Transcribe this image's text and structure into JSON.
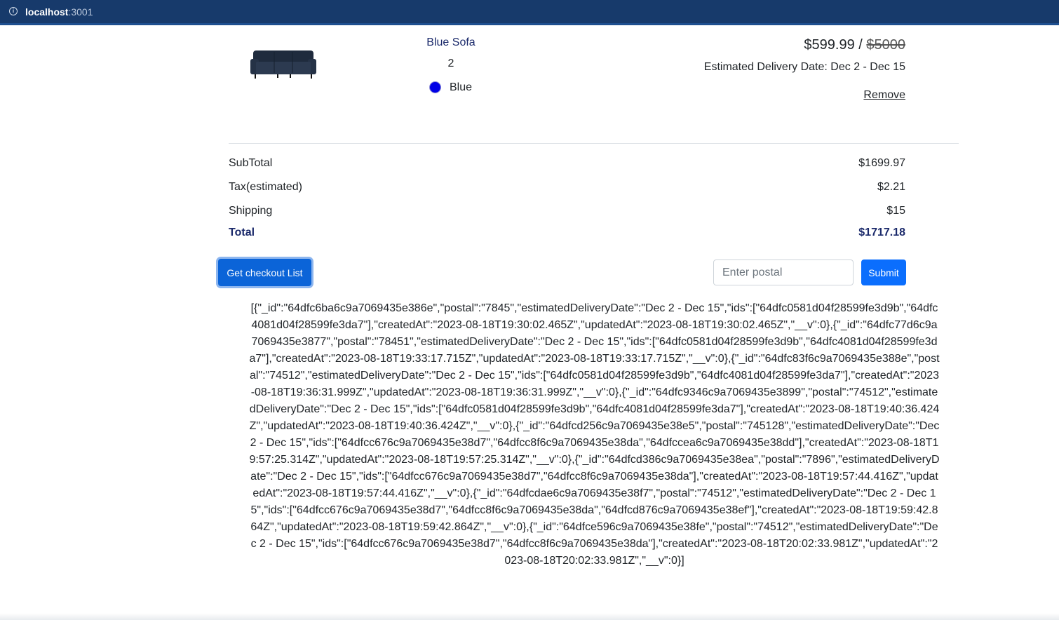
{
  "browser": {
    "url_host": "localhost",
    "url_port": ":3001"
  },
  "cart_item": {
    "name": "Blue Sofa",
    "quantity": "2",
    "color_label": "Blue",
    "color_hex": "#0000e6",
    "price": "$599.99 / ",
    "original_price": "$5000",
    "delivery": "Estimated Delivery Date: Dec 2 - Dec 15",
    "remove_label": "Remove"
  },
  "summary": {
    "subtotal_label": "SubTotal",
    "subtotal_value": "$1699.97",
    "tax_label": "Tax(estimated)",
    "tax_value": "$2.21",
    "shipping_label": "Shipping",
    "shipping_value": "$15",
    "total_label": "Total",
    "total_value": "$1717.18"
  },
  "actions": {
    "checkout_list_label": "Get checkout List",
    "postal_placeholder": "Enter postal",
    "postal_value": "",
    "submit_label": "Submit"
  },
  "checkout_list_output": "[{\"_id\":\"64dfc6ba6c9a7069435e386e\",\"postal\":\"7845\",\"estimatedDeliveryDate\":\"Dec 2 - Dec 15\",\"ids\":[\"64dfc0581d04f28599fe3d9b\",\"64dfc4081d04f28599fe3da7\"],\"createdAt\":\"2023-08-18T19:30:02.465Z\",\"updatedAt\":\"2023-08-18T19:30:02.465Z\",\"__v\":0},{\"_id\":\"64dfc77d6c9a7069435e3877\",\"postal\":\"78451\",\"estimatedDeliveryDate\":\"Dec 2 - Dec 15\",\"ids\":[\"64dfc0581d04f28599fe3d9b\",\"64dfc4081d04f28599fe3da7\"],\"createdAt\":\"2023-08-18T19:33:17.715Z\",\"updatedAt\":\"2023-08-18T19:33:17.715Z\",\"__v\":0},{\"_id\":\"64dfc83f6c9a7069435e388e\",\"postal\":\"74512\",\"estimatedDeliveryDate\":\"Dec 2 - Dec 15\",\"ids\":[\"64dfc0581d04f28599fe3d9b\",\"64dfc4081d04f28599fe3da7\"],\"createdAt\":\"2023-08-18T19:36:31.999Z\",\"updatedAt\":\"2023-08-18T19:36:31.999Z\",\"__v\":0},{\"_id\":\"64dfc9346c9a7069435e3899\",\"postal\":\"74512\",\"estimatedDeliveryDate\":\"Dec 2 - Dec 15\",\"ids\":[\"64dfc0581d04f28599fe3d9b\",\"64dfc4081d04f28599fe3da7\"],\"createdAt\":\"2023-08-18T19:40:36.424Z\",\"updatedAt\":\"2023-08-18T19:40:36.424Z\",\"__v\":0},{\"_id\":\"64dfcd256c9a7069435e38e5\",\"postal\":\"745128\",\"estimatedDeliveryDate\":\"Dec 2 - Dec 15\",\"ids\":[\"64dfcc676c9a7069435e38d7\",\"64dfcc8f6c9a7069435e38da\",\"64dfccea6c9a7069435e38dd\"],\"createdAt\":\"2023-08-18T19:57:25.314Z\",\"updatedAt\":\"2023-08-18T19:57:25.314Z\",\"__v\":0},{\"_id\":\"64dfcd386c9a7069435e38ea\",\"postal\":\"7896\",\"estimatedDeliveryDate\":\"Dec 2 - Dec 15\",\"ids\":[\"64dfcc676c9a7069435e38d7\",\"64dfcc8f6c9a7069435e38da\"],\"createdAt\":\"2023-08-18T19:57:44.416Z\",\"updatedAt\":\"2023-08-18T19:57:44.416Z\",\"__v\":0},{\"_id\":\"64dfcdae6c9a7069435e38f7\",\"postal\":\"74512\",\"estimatedDeliveryDate\":\"Dec 2 - Dec 15\",\"ids\":[\"64dfcc676c9a7069435e38d7\",\"64dfcc8f6c9a7069435e38da\",\"64dfcd876c9a7069435e38ef\"],\"createdAt\":\"2023-08-18T19:59:42.864Z\",\"updatedAt\":\"2023-08-18T19:59:42.864Z\",\"__v\":0},{\"_id\":\"64dfce596c9a7069435e38fe\",\"postal\":\"74512\",\"estimatedDeliveryDate\":\"Dec 2 - Dec 15\",\"ids\":[\"64dfcc676c9a7069435e38d7\",\"64dfcc8f6c9a7069435e38da\"],\"createdAt\":\"2023-08-18T20:02:33.981Z\",\"updatedAt\":\"2023-08-18T20:02:33.981Z\",\"__v\":0}]"
}
